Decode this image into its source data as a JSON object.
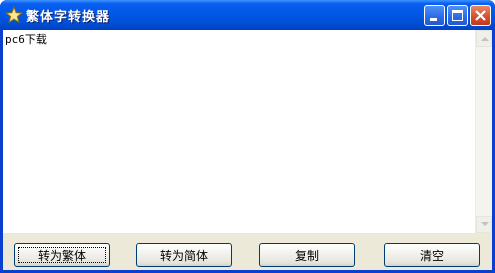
{
  "window": {
    "title": "繁体字转换器",
    "icon": "star-icon"
  },
  "titlebar_buttons": {
    "minimize": "minimize-icon",
    "maximize": "maximize-icon",
    "close": "close-icon"
  },
  "editor": {
    "value": "pc6下载"
  },
  "buttons": {
    "to_traditional": "转为繁体",
    "to_simplified": "转为简体",
    "copy": "复制",
    "clear": "清空"
  },
  "colors": {
    "titlebar": "#0058e6",
    "close_button": "#d5522f",
    "dialog_face": "#ece9d8",
    "button_border": "#003c74"
  }
}
